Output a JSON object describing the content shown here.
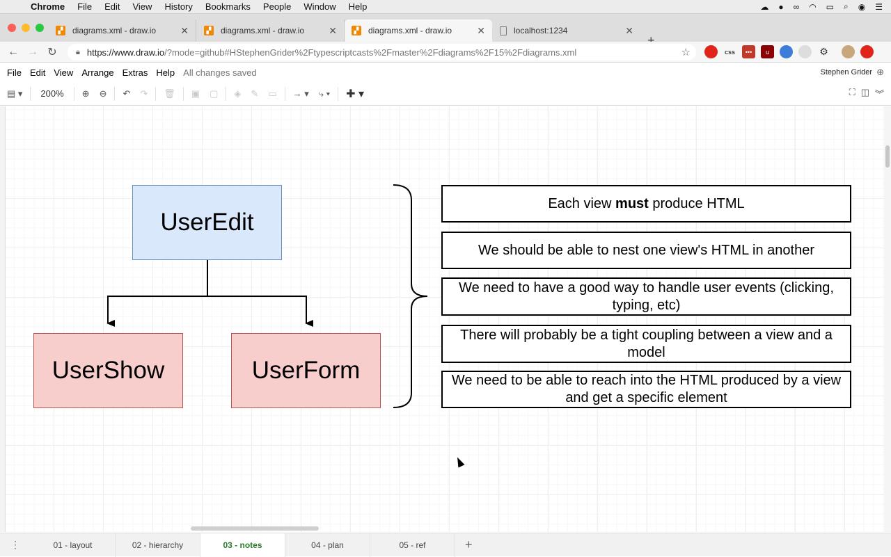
{
  "menubar": {
    "app": "Chrome",
    "items": [
      "File",
      "Edit",
      "View",
      "History",
      "Bookmarks",
      "People",
      "Window",
      "Help"
    ]
  },
  "tabs": [
    {
      "title": "diagrams.xml - draw.io",
      "active": false
    },
    {
      "title": "diagrams.xml - draw.io",
      "active": false
    },
    {
      "title": "diagrams.xml - draw.io",
      "active": true
    },
    {
      "title": "localhost:1234",
      "active": false
    }
  ],
  "address": {
    "host": "https://www.draw.io",
    "path": "/?mode=github#HStephenGrider%2Ftypescriptcasts%2Fmaster%2Fdiagrams%2F15%2Fdiagrams.xml"
  },
  "drawio_menu": {
    "items": [
      "File",
      "Edit",
      "View",
      "Arrange",
      "Extras",
      "Help"
    ],
    "status": "All changes saved",
    "user": "Stephen Grider"
  },
  "toolbar": {
    "zoom": "200%"
  },
  "diagram": {
    "parent": "UserEdit",
    "child_left": "UserShow",
    "child_right": "UserForm",
    "notes": [
      {
        "pre": "Each view ",
        "bold": "must",
        "post": " produce HTML"
      },
      {
        "pre": "We should be able to nest one view's HTML in another",
        "bold": "",
        "post": ""
      },
      {
        "pre": "We need to have a good way to handle user events (clicking, typing, etc)",
        "bold": "",
        "post": ""
      },
      {
        "pre": "There will probably be a tight coupling between a view and a model",
        "bold": "",
        "post": ""
      },
      {
        "pre": "We need to be able to reach into the HTML produced by a view and get a specific element",
        "bold": "",
        "post": ""
      }
    ]
  },
  "sheets": {
    "tabs": [
      "01 - layout",
      "02 - hierarchy",
      "03 - notes",
      "04 - plan",
      "05 - ref"
    ],
    "active": "03 - notes"
  },
  "colors": {
    "parent_fill": "#dae8fc",
    "parent_border": "#6c8ebf",
    "child_fill": "#f8cecc",
    "child_border": "#b85450",
    "active_sheet": "#2b7a2b"
  }
}
